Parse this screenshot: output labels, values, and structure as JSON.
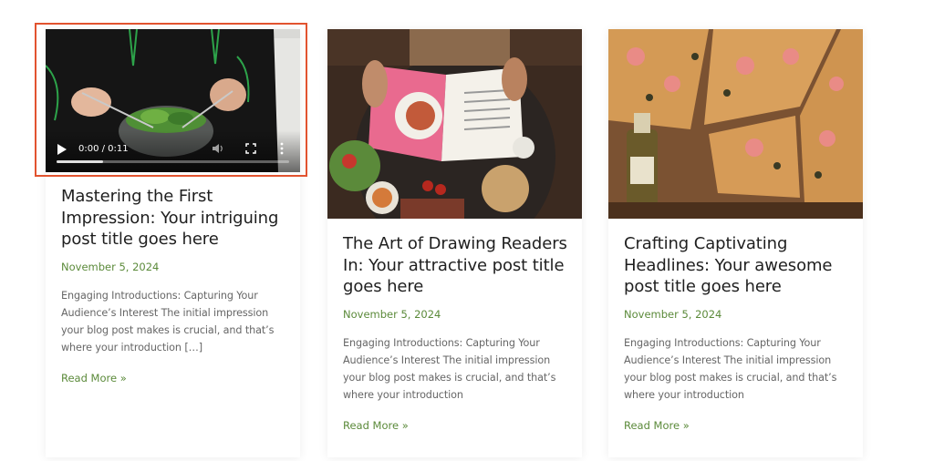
{
  "posts": [
    {
      "title": "Mastering the First Impression: Your intriguing post title goes here",
      "date": "November 5, 2024",
      "excerpt": "Engaging Introductions: Capturing Your Audience’s Interest The initial impression your blog post makes is crucial, and that’s where your introduction […]",
      "read_more": "Read More »",
      "media": "video",
      "video": {
        "time": "0:00 / 0:11",
        "progress": 0.2
      }
    },
    {
      "title": "The Art of Drawing Readers In: Your attractive post title goes here",
      "date": "November 5, 2024",
      "excerpt": "Engaging Introductions: Capturing Your Audience’s Interest The initial impression your blog post makes is crucial, and that’s where your introduction",
      "read_more": "Read More »",
      "media": "image"
    },
    {
      "title": "Crafting Captivating Headlines: Your awesome post title goes here",
      "date": "November 5, 2024",
      "excerpt": "Engaging Introductions: Capturing Your Audience’s Interest The initial impression your blog post makes is crucial, and that’s where your introduction",
      "read_more": "Read More »",
      "media": "image"
    }
  ],
  "colors": {
    "accent": "#5b8a3a",
    "highlight": "#e2532f",
    "title": "#1f1f1f",
    "body_text": "#666666"
  }
}
